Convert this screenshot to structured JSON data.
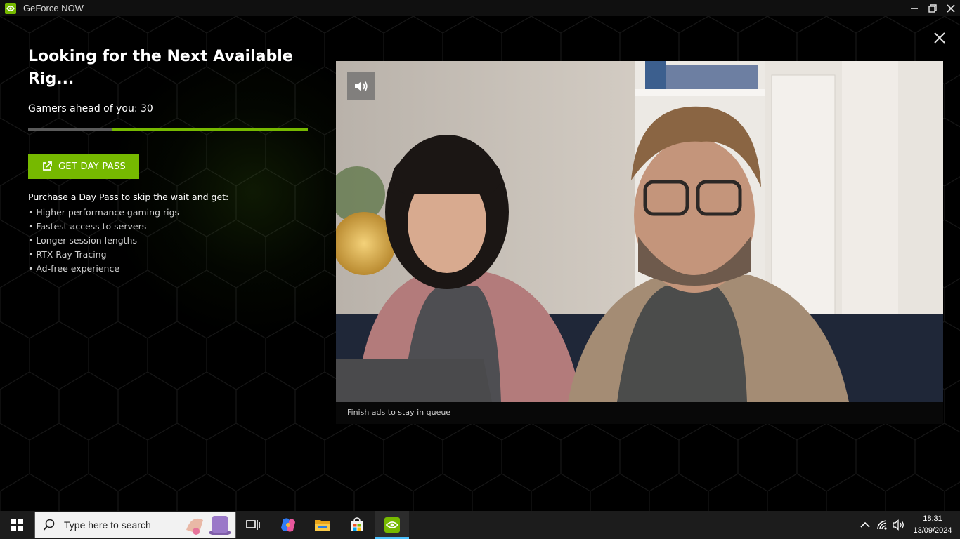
{
  "window": {
    "title": "GeForce NOW",
    "icon": "nvidia-logo-icon"
  },
  "queue_screen": {
    "heading": "Looking for the Next Available Rig...",
    "queue_text": "Gamers ahead of you: 30",
    "progress_fraction": 0.7,
    "day_pass_label": "GET DAY PASS",
    "benefits_title": "Purchase a Day Pass to skip the wait and get:",
    "benefits": [
      "• Higher performance gaming rigs",
      "• Fastest access to servers",
      "• Longer session lengths",
      "• RTX Ray Tracing",
      "• Ad-free experience"
    ]
  },
  "ad": {
    "caption": "Finish ads to stay in queue",
    "sound_icon": "speaker-icon"
  },
  "taskbar": {
    "search_placeholder": "Type here to search",
    "time": "18:31",
    "date": "13/09/2024"
  },
  "colors": {
    "accent": "#76b900",
    "background": "#000000",
    "taskbar": "#1c1c1c"
  }
}
